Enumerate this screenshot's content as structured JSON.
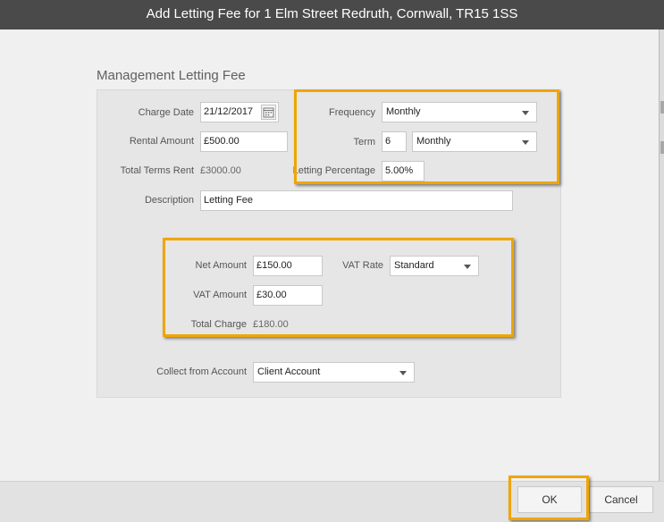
{
  "dialog": {
    "title": "Add Letting Fee for 1 Elm Street Redruth, Cornwall, TR15 1SS"
  },
  "section": {
    "title": "Management Letting Fee"
  },
  "form": {
    "charge_date_label": "Charge Date",
    "charge_date_value": "21/12/2017",
    "rental_amount_label": "Rental Amount",
    "rental_amount_value": "£500.00",
    "total_terms_rent_label": "Total Terms Rent",
    "total_terms_rent_value": "£3000.00",
    "frequency_label": "Frequency",
    "frequency_value": "Monthly",
    "term_label": "Term",
    "term_value": "6",
    "term_unit_value": "Monthly",
    "letting_percentage_label": "Letting Percentage",
    "letting_percentage_value": "5.00%",
    "description_label": "Description",
    "description_value": "Letting Fee",
    "net_amount_label": "Net Amount",
    "net_amount_value": "£150.00",
    "vat_rate_label": "VAT Rate",
    "vat_rate_value": "Standard",
    "vat_amount_label": "VAT Amount",
    "vat_amount_value": "£30.00",
    "total_charge_label": "Total Charge",
    "total_charge_value": "£180.00",
    "collect_from_label": "Collect from Account",
    "collect_from_value": "Client Account"
  },
  "footer": {
    "ok_label": "OK",
    "cancel_label": "Cancel"
  },
  "colors": {
    "highlight": "#f0a500",
    "titlebar": "#4a4a4a"
  },
  "icons": [
    "calendar-icon",
    "chevron-down-icon"
  ]
}
